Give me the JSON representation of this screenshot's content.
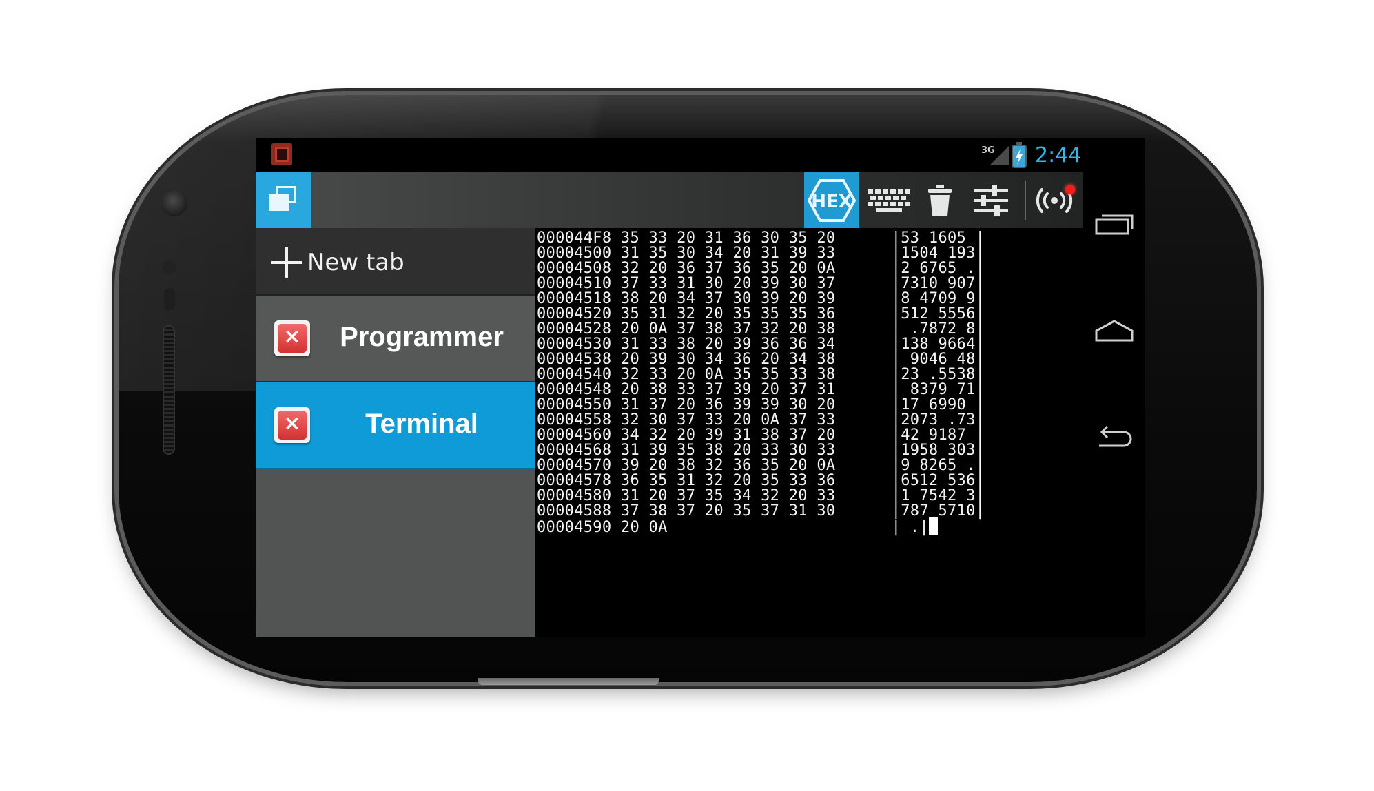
{
  "status_bar": {
    "network_label": "3G",
    "clock": "2:44",
    "icons": [
      "app-notification-icon",
      "signal-icon",
      "battery-charging-icon"
    ]
  },
  "action_bar": {
    "tabs_toggle_icon": "tabs-icon",
    "hex_label": "HEX",
    "buttons": [
      "hex-mode",
      "keyboard",
      "trash",
      "settings",
      "connection"
    ],
    "colors": {
      "accent": "#29a8df",
      "hex_bg": "#1f9ad3",
      "indicator": "#ff1a1a"
    }
  },
  "drawer": {
    "new_tab_label": "New tab",
    "tabs": [
      {
        "label": "Programmer",
        "selected": false
      },
      {
        "label": "Terminal",
        "selected": true
      }
    ]
  },
  "terminal": {
    "lines": [
      "000044F8 35 33 20 31 36 30 35 20      |53 1605 |",
      "00004500 31 35 30 34 20 31 39 33      |1504 193|",
      "00004508 32 20 36 37 36 35 20 0A      |2 6765 .|",
      "00004510 37 33 31 30 20 39 30 37      |7310 907|",
      "00004518 38 20 34 37 30 39 20 39      |8 4709 9|",
      "00004520 35 31 32 20 35 35 35 36      |512 5556|",
      "00004528 20 0A 37 38 37 32 20 38      | .7872 8|",
      "00004530 31 33 38 20 39 36 36 34      |138 9664|",
      "00004538 20 39 30 34 36 20 34 38      | 9046 48|",
      "00004540 32 33 20 0A 35 35 33 38      |23 .5538|",
      "00004548 20 38 33 37 39 20 37 31      | 8379 71|",
      "00004550 31 37 20 36 39 39 30 20      |17 6990 |",
      "00004558 32 30 37 33 20 0A 37 33      |2073 .73|",
      "00004560 34 32 20 39 31 38 37 20      |42 9187 |",
      "00004568 31 39 35 38 20 33 30 33      |1958 303|",
      "00004570 39 20 38 32 36 35 20 0A      |9 8265 .|",
      "00004578 36 35 31 32 20 35 33 36      |6512 536|",
      "00004580 31 20 37 35 34 32 20 33      |1 7542 3|",
      "00004588 37 38 37 20 35 37 31 30      |787 5710|",
      "00004590 20 0A                        | .|"
    ]
  },
  "nav_bar": {
    "buttons": [
      "recent-apps-icon",
      "home-icon",
      "back-icon"
    ]
  }
}
